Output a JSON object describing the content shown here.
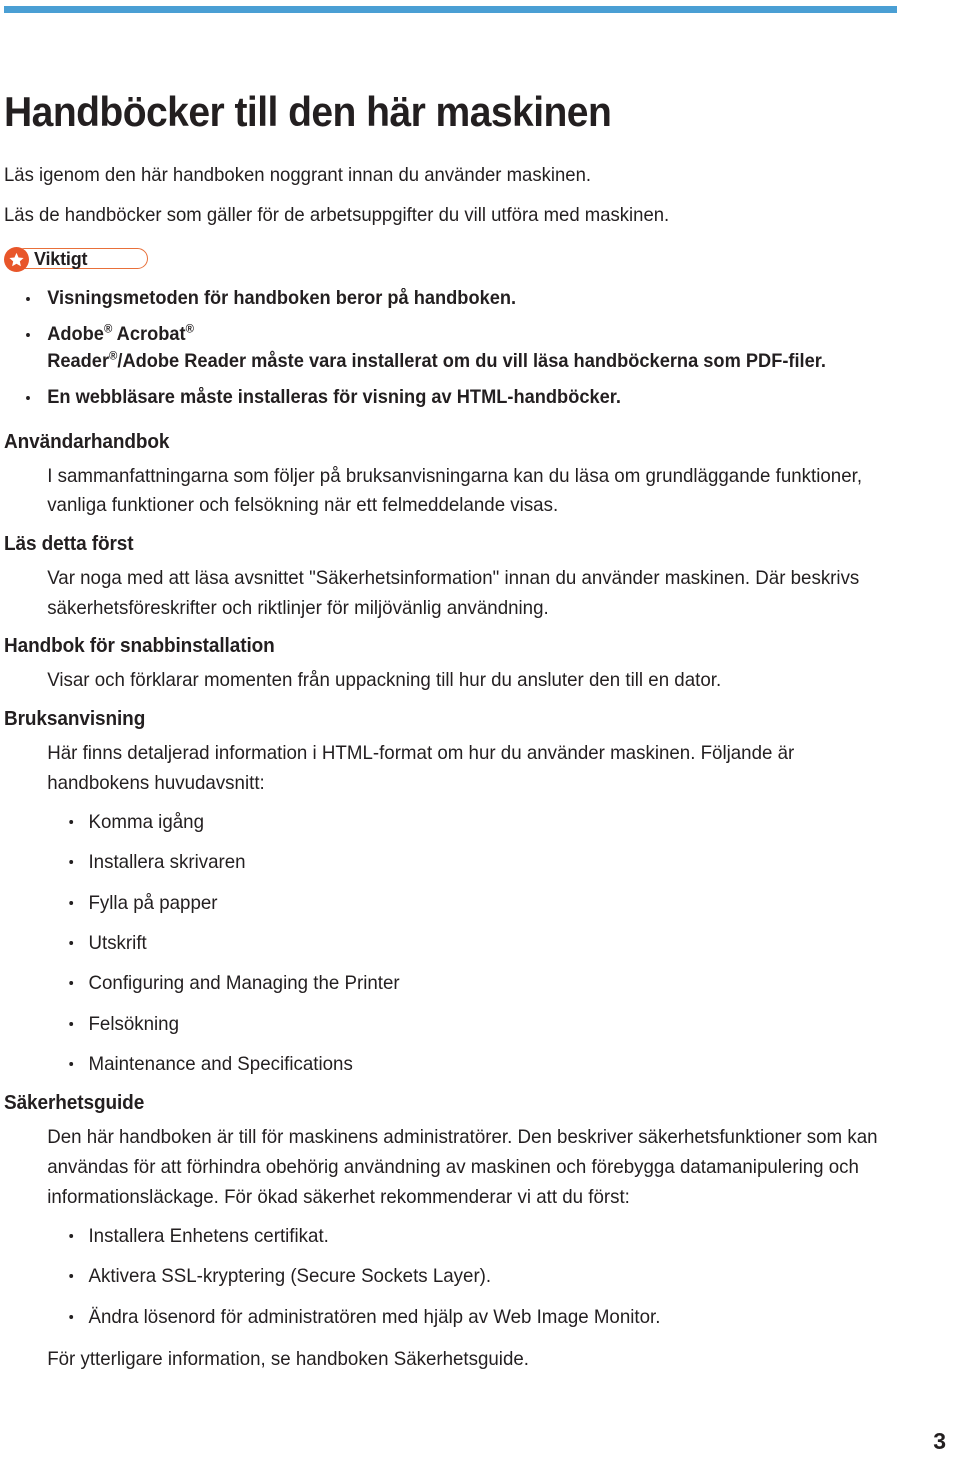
{
  "theme": {
    "rule_color": "#4a9fd4",
    "text_color": "#231f20",
    "badge_orange": "#e8562a",
    "badge_outline": "#e8703a"
  },
  "document": {
    "title": "Handböcker till den här maskinen",
    "intro": [
      "Läs igenom den här handboken noggrant innan du använder maskinen.",
      "Läs de handböcker som gäller för de arbetsuppgifter du vill utföra med maskinen."
    ],
    "page_number": "3"
  },
  "important_box": {
    "label": "Viktigt",
    "icon": "star-icon",
    "items": [
      {
        "text": "Visningsmetoden för handboken beror på handboken.",
        "has_registered_marks": false
      },
      {
        "text": "Adobe ® Acrobat ® Reader ®/Adobe Reader måste vara installerat om du vill läsa handböckerna som PDF-filer.",
        "has_registered_marks": true,
        "line1_a": "Adobe",
        "line1_b": " Acrobat",
        "line2_a": "Reader",
        "line2_b": "/Adobe Reader måste vara installerat om du vill läsa handböckerna som PDF-filer.",
        "reg": "®"
      },
      {
        "text": "En webbläsare måste installeras för visning av HTML-handböcker.",
        "has_registered_marks": false
      }
    ]
  },
  "sections": [
    {
      "heading": "Användarhandbok",
      "body": "I sammanfattningarna som följer på bruksanvisningarna kan du läsa om grundläggande funktioner, vanliga funktioner och felsökning när ett felmeddelande visas."
    },
    {
      "heading": "Läs detta först",
      "body": "Var noga med att läsa avsnittet \"Säkerhetsinformation\" innan du använder maskinen. Där beskrivs säkerhetsföreskrifter och riktlinjer för miljövänlig användning."
    },
    {
      "heading": "Handbok för snabbinstallation",
      "body": "Visar och förklarar momenten från uppackning till hur du ansluter den till en dator."
    },
    {
      "heading": "Bruksanvisning",
      "body": "Här finns detaljerad information i HTML-format om hur du använder maskinen. Följande är handbokens huvudavsnitt:",
      "bullets": [
        "Komma igång",
        "Installera skrivaren",
        "Fylla på papper",
        "Utskrift",
        "Configuring and Managing the Printer",
        "Felsökning",
        "Maintenance and Specifications"
      ]
    },
    {
      "heading": "Säkerhetsguide",
      "body": "Den här handboken är till för maskinens administratörer. Den beskriver säkerhetsfunktioner som kan användas för att förhindra obehörig användning av maskinen och förebygga datamanipulering och informationsläckage. För ökad säkerhet rekommenderar vi att du först:",
      "bullets": [
        "Installera Enhetens certifikat.",
        "Aktivera SSL-kryptering (Secure Sockets Layer).",
        "Ändra lösenord för administratören med hjälp av Web Image Monitor."
      ],
      "footer": "För ytterligare information, se handboken Säkerhetsguide."
    }
  ]
}
